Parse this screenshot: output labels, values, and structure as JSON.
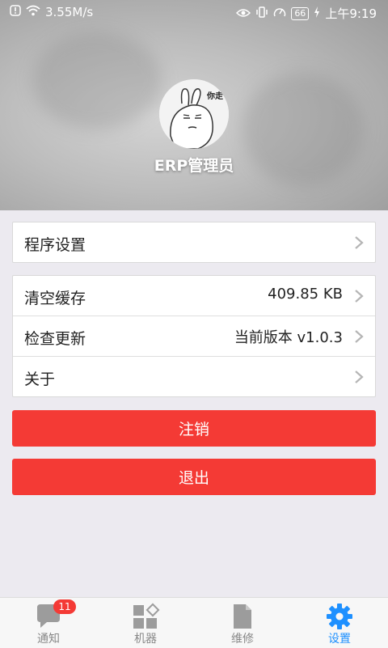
{
  "status_bar": {
    "speed": "3.55M/s",
    "battery": "66",
    "time": "上午9:19"
  },
  "profile": {
    "name": "ERP管理员",
    "avatar_text": "你走"
  },
  "settings": {
    "program_settings": "程序设置",
    "clear_cache": "清空缓存",
    "cache_size": "409.85 KB",
    "check_update": "检查更新",
    "current_version": "当前版本 v1.0.3",
    "about": "关于"
  },
  "buttons": {
    "logout": "注销",
    "exit": "退出"
  },
  "tabs": [
    {
      "label": "通知",
      "badge": "11"
    },
    {
      "label": "机器"
    },
    {
      "label": "维修"
    },
    {
      "label": "设置"
    }
  ],
  "colors": {
    "accent": "#1e90ff",
    "danger": "#f43a35"
  }
}
